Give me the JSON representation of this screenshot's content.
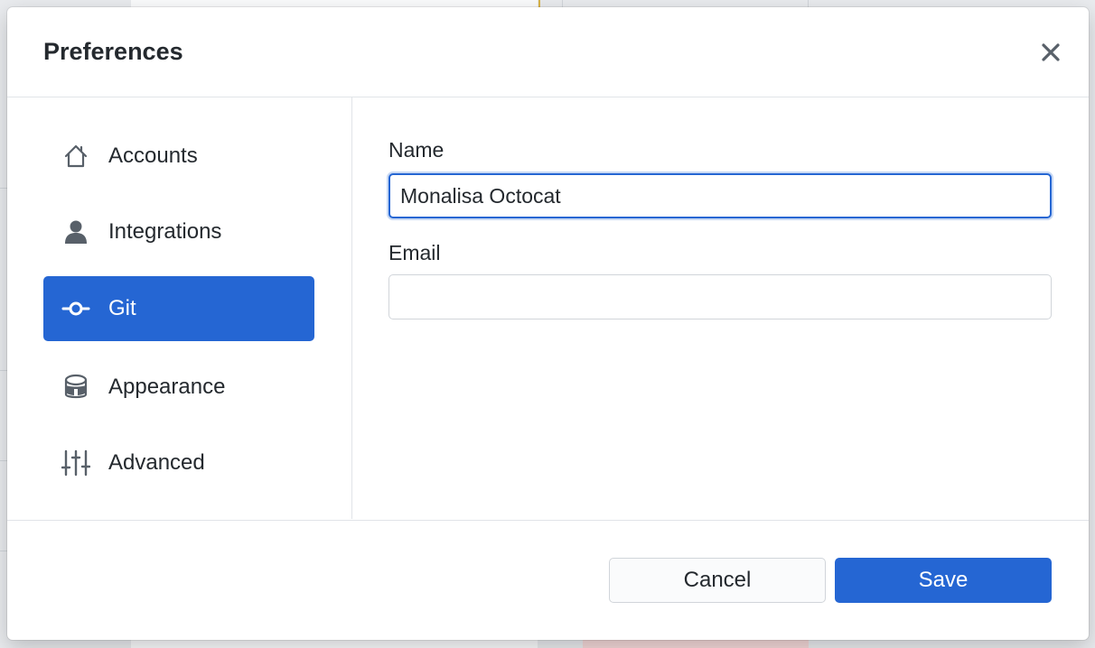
{
  "dialog": {
    "title": "Preferences",
    "close_icon": "close-icon"
  },
  "sidebar": {
    "items": [
      {
        "label": "Accounts",
        "icon": "home-icon",
        "active": false
      },
      {
        "label": "Integrations",
        "icon": "person-icon",
        "active": false
      },
      {
        "label": "Git",
        "icon": "git-commit-icon",
        "active": true
      },
      {
        "label": "Appearance",
        "icon": "paintcan-icon",
        "active": false
      },
      {
        "label": "Advanced",
        "icon": "settings-sliders-icon",
        "active": false
      }
    ]
  },
  "form": {
    "name_label": "Name",
    "name_value": "Monalisa Octocat",
    "email_label": "Email",
    "email_value": ""
  },
  "footer": {
    "cancel_label": "Cancel",
    "save_label": "Save"
  },
  "colors": {
    "accent": "#2566d3",
    "text": "#24292e",
    "border": "#e1e4e8"
  }
}
